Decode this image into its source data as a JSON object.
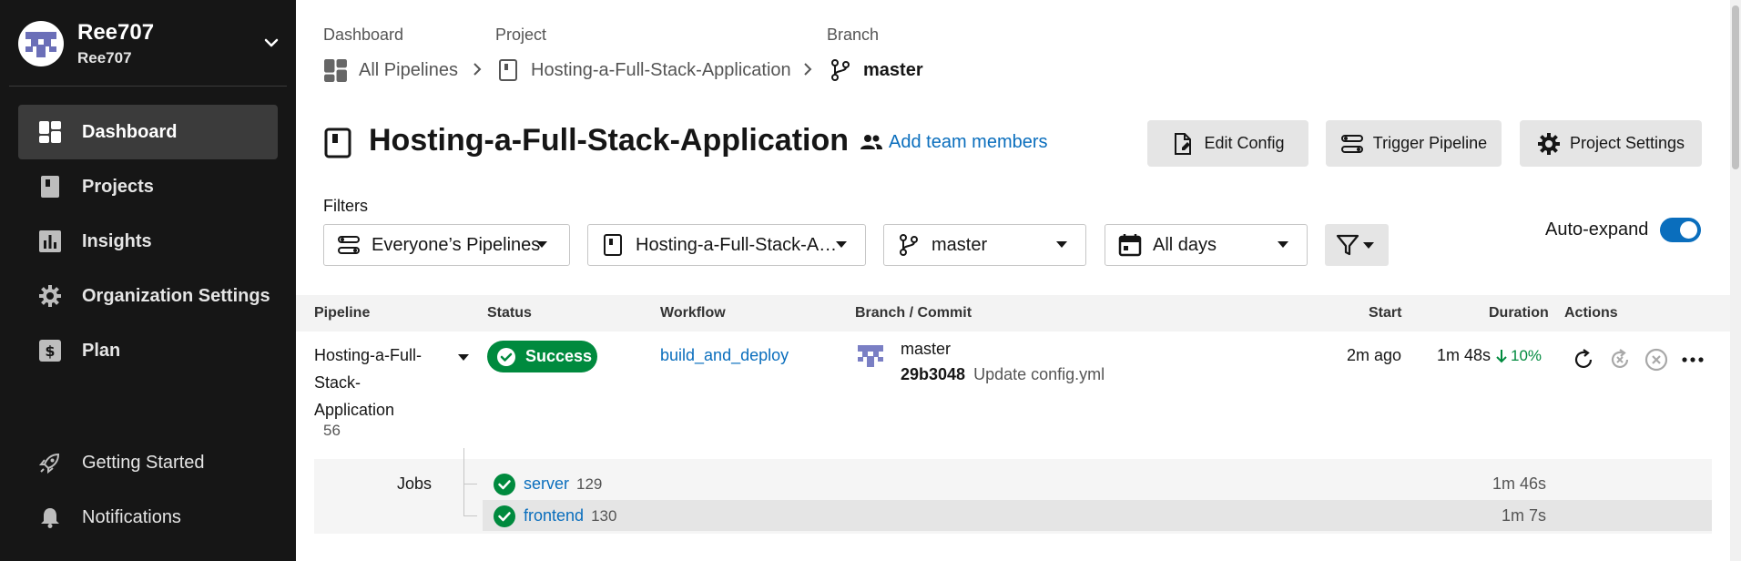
{
  "sidebar": {
    "org_name": "Ree707",
    "org_sub": "Ree707",
    "items": [
      {
        "label": "Dashboard",
        "icon": "dashboard-icon",
        "active": true
      },
      {
        "label": "Projects",
        "icon": "projects-icon"
      },
      {
        "label": "Insights",
        "icon": "insights-icon"
      },
      {
        "label": "Organization Settings",
        "icon": "gear-icon"
      },
      {
        "label": "Plan",
        "icon": "dollar-icon"
      }
    ],
    "bottom_items": [
      {
        "label": "Getting Started",
        "icon": "rocket-icon"
      },
      {
        "label": "Notifications",
        "icon": "bell-icon"
      }
    ]
  },
  "breadcrumb": {
    "labels": [
      "Dashboard",
      "Project",
      "Branch"
    ],
    "items": [
      "All Pipelines",
      "Hosting-a-Full-Stack-Application",
      "master"
    ]
  },
  "header": {
    "title": "Hosting-a-Full-Stack-Application",
    "add_team": "Add team members",
    "buttons": {
      "edit_config": "Edit Config",
      "trigger_pipeline": "Trigger Pipeline",
      "project_settings": "Project Settings"
    }
  },
  "filters": {
    "label": "Filters",
    "pipelines": "Everyone’s Pipelines",
    "project": "Hosting-a-Full-Stack-A…",
    "branch": "master",
    "date": "All days",
    "auto_expand_label": "Auto-expand",
    "auto_expand_on": true
  },
  "table": {
    "headers": [
      "Pipeline",
      "Status",
      "Workflow",
      "Branch / Commit",
      "Start",
      "Duration",
      "Actions"
    ],
    "row": {
      "pipeline_name": "Hosting-a-Full-Stack-Application",
      "pipeline_number": "56",
      "status": "Success",
      "workflow": "build_and_deploy",
      "branch": "master",
      "commit_hash": "29b3048",
      "commit_message": "Update config.yml",
      "start": "2m ago",
      "duration": "1m 48s",
      "duration_change": "10%"
    },
    "jobs_label": "Jobs",
    "jobs": [
      {
        "name": "server",
        "number": "129",
        "duration": "1m 46s"
      },
      {
        "name": "frontend",
        "number": "130",
        "duration": "1m 7s"
      }
    ]
  },
  "colors": {
    "sidebar_bg": "#161616",
    "accent_blue": "#0a6ebd",
    "success_green": "#008a3e"
  }
}
